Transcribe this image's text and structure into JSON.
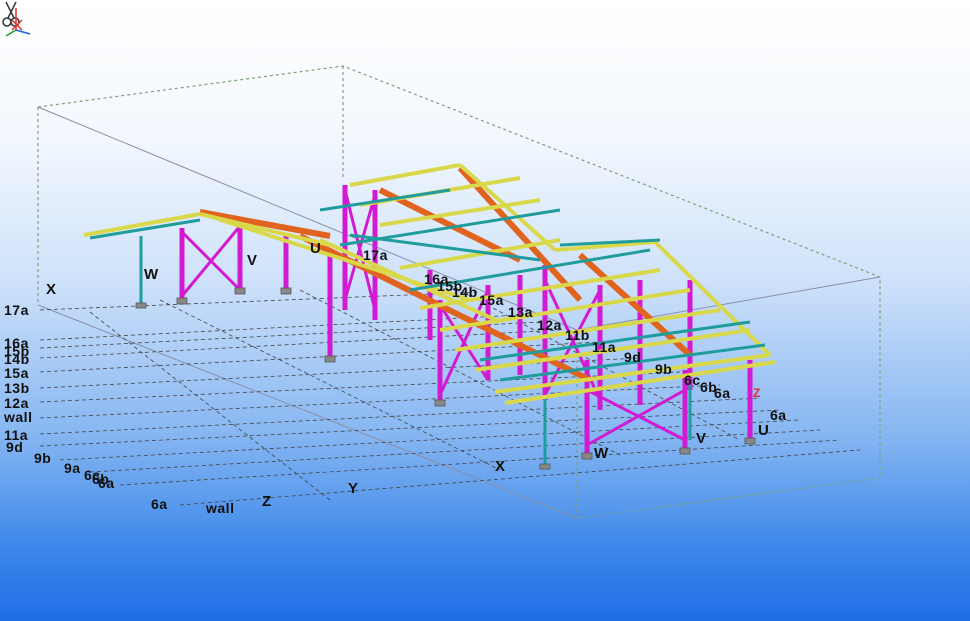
{
  "view": {
    "colors": {
      "column": "#d21ad2",
      "beam_yellow": "#d8d84a",
      "beam_teal": "#1f9c9c",
      "beam_orange": "#e0641e",
      "grid": "#5a5a5a",
      "box": "#7fa07a"
    }
  },
  "grid_labels_left": [
    "17a",
    "16a",
    "15b",
    "14b",
    "15a",
    "13b",
    "12a",
    "wall",
    "11a",
    "9d",
    "9b",
    "9a",
    "6c",
    "6b",
    "6a",
    "6a",
    "wall"
  ],
  "grid_labels_model": [
    "17a",
    "16a",
    "15b",
    "14b",
    "15a",
    "13a",
    "12a",
    "11b",
    "11a",
    "9d",
    "9b",
    "6c",
    "6b",
    "6a",
    "6a"
  ],
  "axis_labels": [
    "X",
    "W",
    "V",
    "U",
    "Z",
    "Y",
    "X",
    "W",
    "V",
    "U",
    "Z"
  ],
  "icons": {
    "cursor": "scissors-icon",
    "axes": "coordinate-axes-icon"
  }
}
